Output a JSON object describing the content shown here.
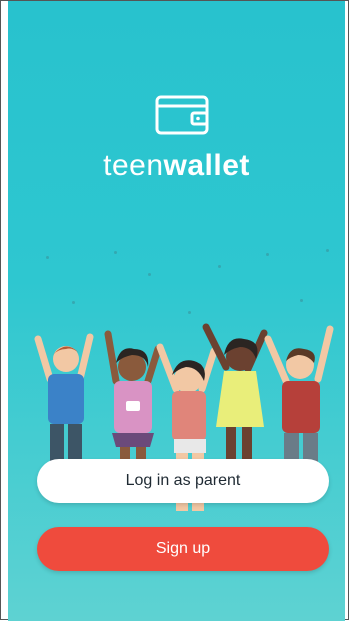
{
  "brand": {
    "name_light": "teen",
    "name_bold": "wallet",
    "logo_icon": "wallet-icon"
  },
  "illustration": {
    "icon": "happy-kids-illustration"
  },
  "actions": {
    "login_label": "Log in as parent",
    "signup_label": "Sign up"
  },
  "colors": {
    "background": "#2ec7d0",
    "login_button": "#ffffff",
    "signup_button": "#ef4b3d",
    "text_on_light": "#1f2a33",
    "text_on_dark": "#ffffff"
  }
}
